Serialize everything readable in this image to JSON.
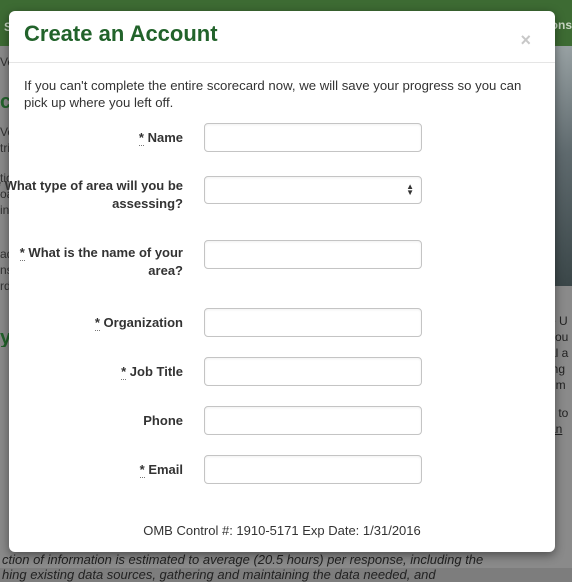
{
  "background": {
    "top_left_text": "S",
    "top_right_text": "ons",
    "left_fragments": [
      "Ve",
      "ct",
      "Ve",
      "tri",
      "tic",
      "oa",
      "in",
      "ar",
      "ad",
      "ns",
      "e",
      "rd",
      "y"
    ],
    "right_fragments": [
      "e U",
      "cou",
      "al a",
      "ing",
      "nm",
      "s to",
      "an"
    ],
    "bottom_lines": [
      "ction of information is estimated to average (20.5 hours) per response, including the",
      "hing existing data sources, gathering and maintaining the data needed, and"
    ]
  },
  "modal": {
    "title": "Create an Account",
    "close_glyph": "×",
    "intro": "If you can't complete the entire scorecard now, we will save your progress so you can pick up where you left off.",
    "required_marker": "*",
    "fields": [
      {
        "label": "Name",
        "required": true,
        "type": "text",
        "value": ""
      },
      {
        "label": "What type of area will you be assessing?",
        "required": true,
        "type": "select",
        "value": ""
      },
      {
        "label": "What is the name of your area?",
        "required": true,
        "type": "text",
        "value": ""
      },
      {
        "label": "Organization",
        "required": true,
        "type": "text",
        "value": ""
      },
      {
        "label": "Job Title",
        "required": true,
        "type": "text",
        "value": ""
      },
      {
        "label": "Phone",
        "required": false,
        "type": "text",
        "value": ""
      },
      {
        "label": "Email",
        "required": true,
        "type": "text",
        "value": ""
      }
    ],
    "omb_text": "OMB Control #: 1910-5171 Exp Date: 1/31/2016"
  },
  "colors": {
    "title_green": "#22632b",
    "topbar_green": "#3d6b33"
  },
  "icons": {
    "close": "close-icon",
    "select_arrows": "select-arrows-icon"
  }
}
